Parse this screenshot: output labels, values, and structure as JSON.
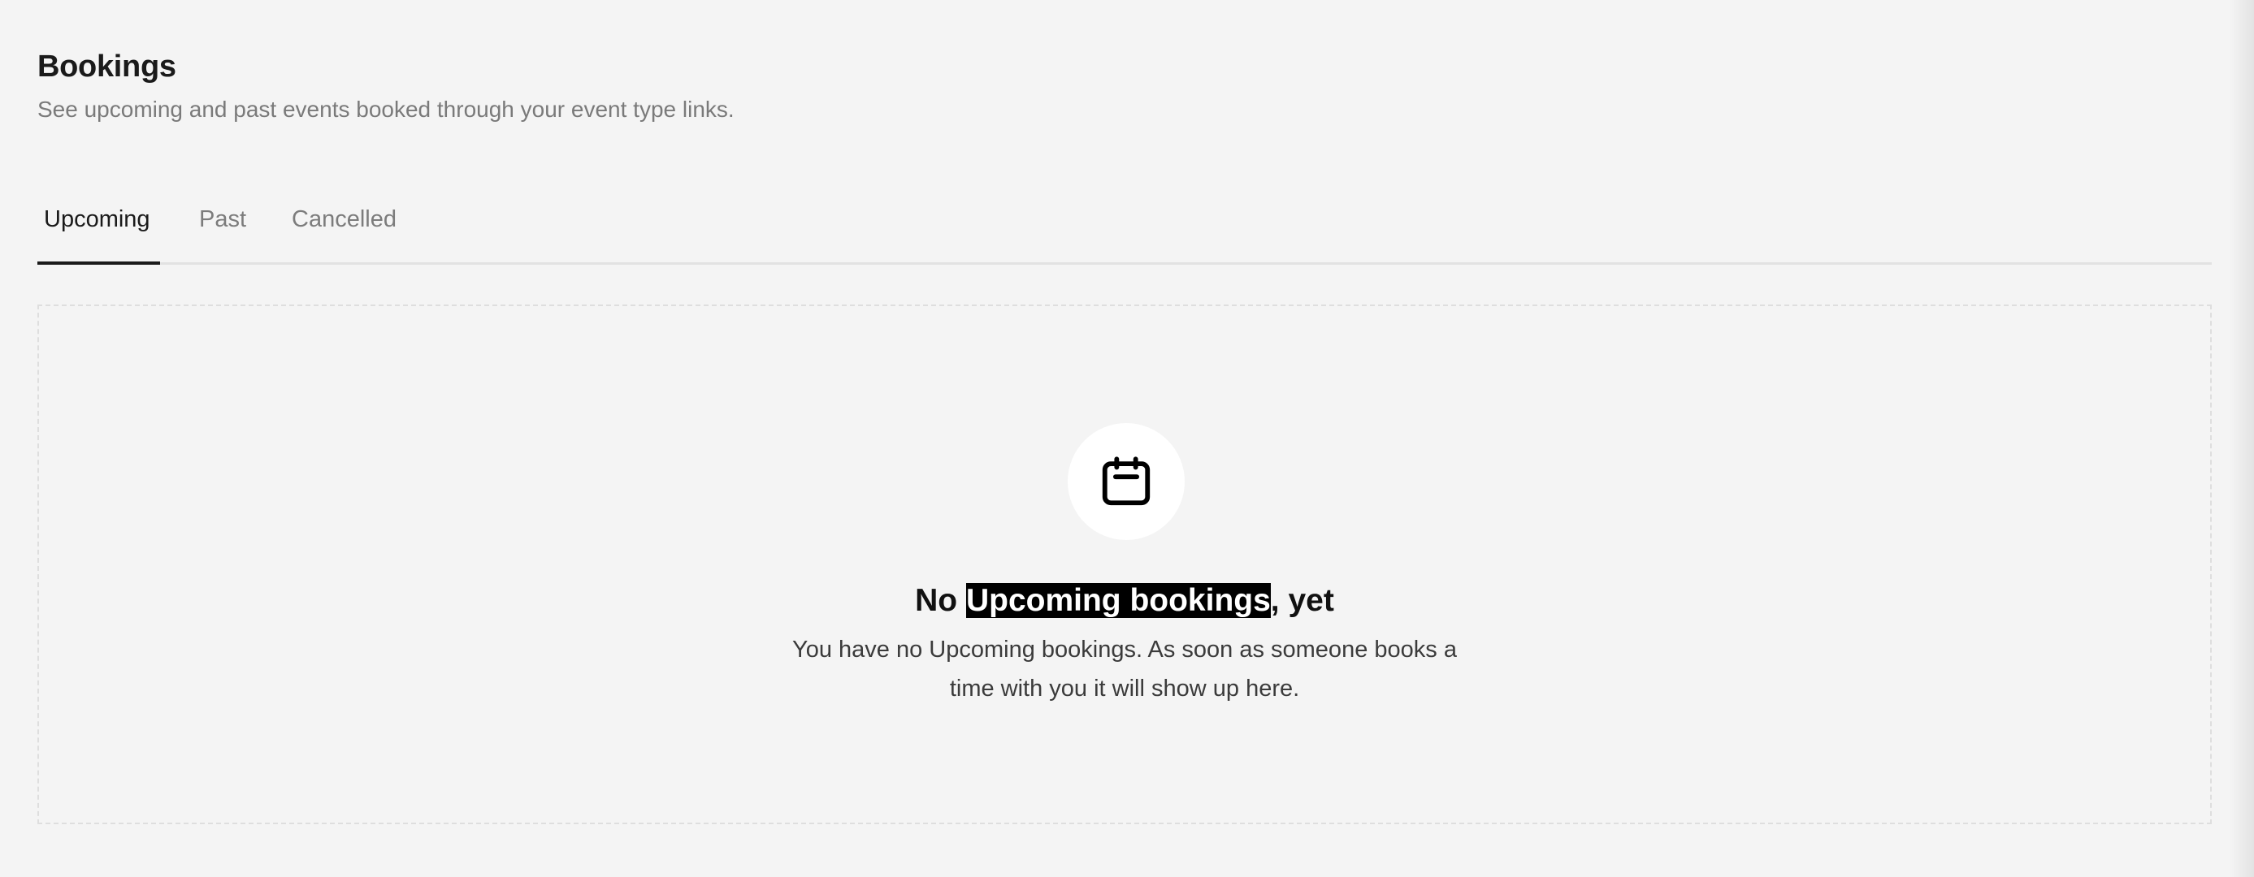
{
  "header": {
    "title": "Bookings",
    "subtitle": "See upcoming and past events booked through your event type links."
  },
  "tabs": [
    {
      "label": "Upcoming",
      "active": true
    },
    {
      "label": "Past",
      "active": false
    },
    {
      "label": "Cancelled",
      "active": false
    }
  ],
  "empty_state": {
    "icon": "calendar-icon",
    "title_prefix": "No ",
    "title_highlight": "Upcoming bookings",
    "title_suffix": ", yet",
    "description": "You have no Upcoming bookings. As soon as someone books a time with you it will show up here."
  },
  "colors": {
    "background": "#f4f4f4",
    "text_primary": "#1a1a1a",
    "text_muted": "#7a7a7a",
    "active_tab_underline": "#1a1a1a",
    "highlight_bg": "#000000",
    "highlight_text": "#ffffff"
  }
}
